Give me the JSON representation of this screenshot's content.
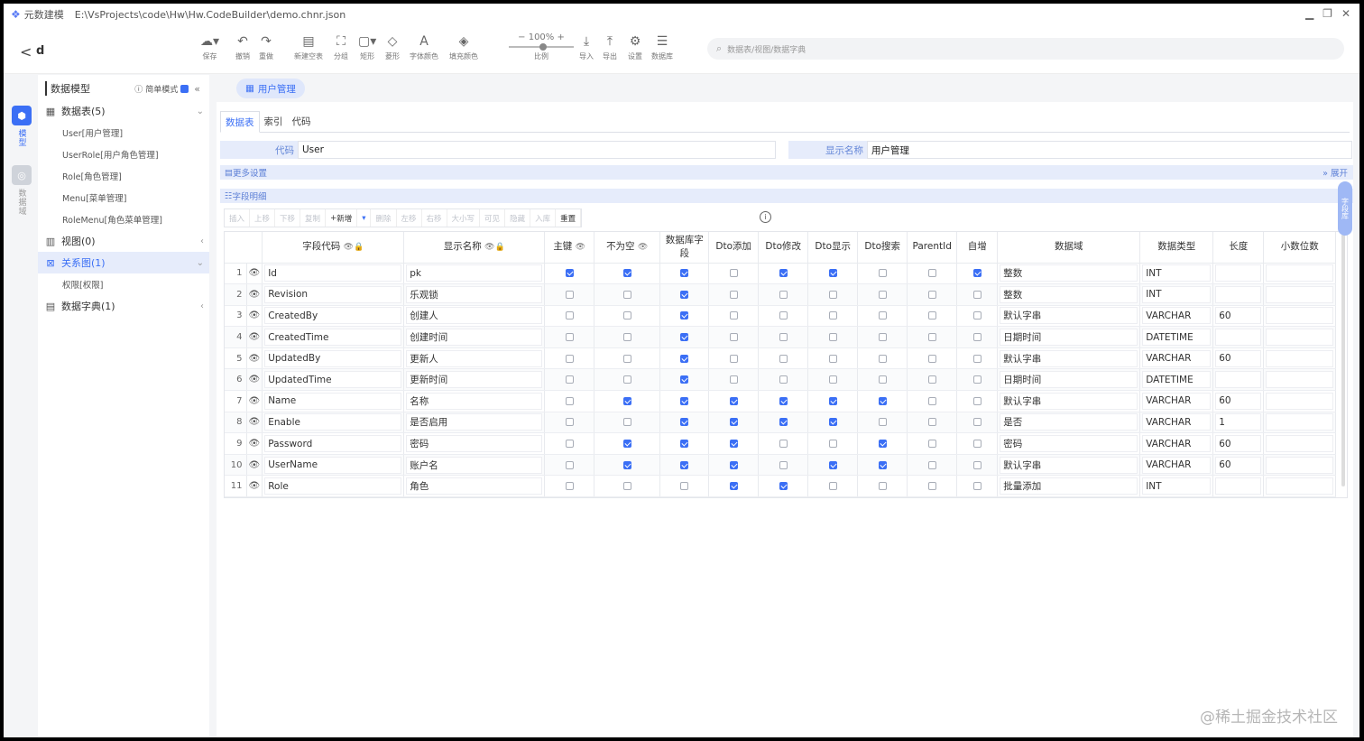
{
  "titlebar": {
    "app": "元数建模",
    "path": "E:\\VsProjects\\code\\Hw\\Hw.CodeBuilder\\demo.chnr.json",
    "min": "▁",
    "restore": "❐",
    "close": "✕"
  },
  "toolbar": {
    "back": "<",
    "project": "d",
    "buttons": [
      {
        "label": "保存",
        "icon": "cloud-upload-icon"
      },
      {
        "label": "撤销",
        "icon": "undo-icon"
      },
      {
        "label": "重做",
        "icon": "redo-icon"
      },
      {
        "label": "新建空表",
        "icon": "new-table-icon"
      },
      {
        "label": "分组",
        "icon": "group-icon"
      },
      {
        "label": "矩形",
        "icon": "rect-icon"
      },
      {
        "label": "菱形",
        "icon": "diamond-icon"
      },
      {
        "label": "字体颜色",
        "icon": "font-color-icon"
      },
      {
        "label": "填充颜色",
        "icon": "fill-color-icon"
      },
      {
        "label": "导入",
        "icon": "import-icon"
      },
      {
        "label": "导出",
        "icon": "export-icon"
      },
      {
        "label": "设置",
        "icon": "gear-icon"
      },
      {
        "label": "数据库",
        "icon": "database-icon"
      }
    ],
    "zoom": {
      "value": "100%",
      "label": "比例",
      "minus": "−",
      "plus": "+"
    },
    "search_placeholder": "数据表/视图/数据字典"
  },
  "rail": {
    "model": "模型",
    "domain": "数据域"
  },
  "tree": {
    "title": "数据模型",
    "simple_mode": "简单模式",
    "collapse": "«",
    "nodes": {
      "tables": "数据表(5)",
      "tables_children": [
        "User[用户管理]",
        "UserRole[用户角色管理]",
        "Role[角色管理]",
        "Menu[菜单管理]",
        "RoleMenu[角色菜单管理]"
      ],
      "views": "视图(0)",
      "relations": "关系图(1)",
      "relations_children": [
        "权限[权限]"
      ],
      "dicts": "数据字典(1)"
    }
  },
  "main": {
    "page_tab": "用户管理",
    "sub_tabs": [
      "数据表",
      "索引",
      "代码"
    ],
    "code_label": "代码",
    "code_value": "User",
    "display_label": "显示名称",
    "display_value": "用户管理",
    "more_settings": "更多设置",
    "expand": "展开",
    "field_detail": "字段明细",
    "actions": [
      "插入",
      "上移",
      "下移",
      "复制",
      "新增",
      "▾",
      "删除",
      "左移",
      "右移",
      "大小写",
      "可见",
      "隐藏",
      "入库",
      "重置"
    ],
    "right_pill": "字段库",
    "columns": [
      "",
      "",
      "字段代码",
      "显示名称",
      "主键",
      "不为空",
      "数据库字段",
      "Dto添加",
      "Dto修改",
      "Dto显示",
      "Dto搜索",
      "ParentId",
      "自增",
      "数据域",
      "数据类型",
      "长度",
      "小数位数"
    ],
    "rows": [
      {
        "no": "1",
        "code": "Id",
        "name": "pk",
        "flags": [
          1,
          1,
          1,
          0,
          1,
          1,
          0,
          0,
          1
        ],
        "domain": "整数",
        "type": "INT",
        "len": "",
        "dec": ""
      },
      {
        "no": "2",
        "code": "Revision",
        "name": "乐观锁",
        "flags": [
          0,
          0,
          1,
          0,
          0,
          0,
          0,
          0,
          0
        ],
        "domain": "整数",
        "type": "INT",
        "len": "",
        "dec": ""
      },
      {
        "no": "3",
        "code": "CreatedBy",
        "name": "创建人",
        "flags": [
          0,
          0,
          1,
          0,
          0,
          0,
          0,
          0,
          0
        ],
        "domain": "默认字串",
        "type": "VARCHAR",
        "len": "60",
        "dec": ""
      },
      {
        "no": "4",
        "code": "CreatedTime",
        "name": "创建时间",
        "flags": [
          0,
          0,
          1,
          0,
          0,
          0,
          0,
          0,
          0
        ],
        "domain": "日期时间",
        "type": "DATETIME",
        "len": "",
        "dec": ""
      },
      {
        "no": "5",
        "code": "UpdatedBy",
        "name": "更新人",
        "flags": [
          0,
          0,
          1,
          0,
          0,
          0,
          0,
          0,
          0
        ],
        "domain": "默认字串",
        "type": "VARCHAR",
        "len": "60",
        "dec": ""
      },
      {
        "no": "6",
        "code": "UpdatedTime",
        "name": "更新时间",
        "flags": [
          0,
          0,
          1,
          0,
          0,
          0,
          0,
          0,
          0
        ],
        "domain": "日期时间",
        "type": "DATETIME",
        "len": "",
        "dec": ""
      },
      {
        "no": "7",
        "code": "Name",
        "name": "名称",
        "flags": [
          0,
          1,
          1,
          1,
          1,
          1,
          1,
          0,
          0
        ],
        "domain": "默认字串",
        "type": "VARCHAR",
        "len": "60",
        "dec": ""
      },
      {
        "no": "8",
        "code": "Enable",
        "name": "是否启用",
        "flags": [
          0,
          0,
          1,
          1,
          1,
          1,
          0,
          0,
          0
        ],
        "domain": "是否",
        "type": "VARCHAR",
        "len": "1",
        "dec": ""
      },
      {
        "no": "9",
        "code": "Password",
        "name": "密码",
        "flags": [
          0,
          1,
          1,
          1,
          0,
          0,
          1,
          0,
          0
        ],
        "domain": "密码",
        "type": "VARCHAR",
        "len": "60",
        "dec": ""
      },
      {
        "no": "10",
        "code": "UserName",
        "name": "账户名",
        "flags": [
          0,
          1,
          1,
          1,
          0,
          1,
          1,
          0,
          0
        ],
        "domain": "默认字串",
        "type": "VARCHAR",
        "len": "60",
        "dec": ""
      },
      {
        "no": "11",
        "code": "Role",
        "name": "角色",
        "flags": [
          0,
          0,
          0,
          1,
          1,
          0,
          0,
          0,
          0
        ],
        "domain": "批量添加",
        "type": "INT",
        "len": "",
        "dec": ""
      }
    ]
  },
  "watermark": "@稀土掘金技术社区",
  "colors": {
    "accent": "#3b6ff5",
    "label_bg": "#e6ecfb"
  }
}
